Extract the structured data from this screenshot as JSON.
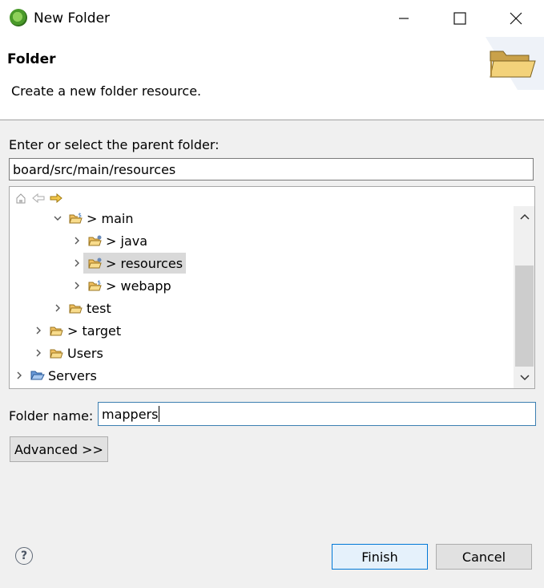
{
  "window": {
    "title": "New Folder"
  },
  "header": {
    "title": "Folder",
    "description": "Create a new folder resource."
  },
  "parent": {
    "label": "Enter or select the parent folder:",
    "value": "board/src/main/resources"
  },
  "tree": {
    "items": [
      {
        "label": "> main",
        "expanded": true,
        "icon": "source-folder-icon"
      },
      {
        "label": "> java",
        "expanded": false,
        "icon": "folder-icon"
      },
      {
        "label": "> resources",
        "expanded": false,
        "icon": "folder-icon",
        "selected": true
      },
      {
        "label": "> webapp",
        "expanded": false,
        "icon": "source-folder-icon"
      },
      {
        "label": "test",
        "expanded": false,
        "icon": "folder-icon"
      },
      {
        "label": "> target",
        "expanded": false,
        "icon": "folder-icon"
      },
      {
        "label": "Users",
        "expanded": false,
        "icon": "folder-icon"
      },
      {
        "label": "Servers",
        "expanded": false,
        "icon": "open-folder-icon"
      }
    ]
  },
  "folder_name": {
    "label": "Folder name:",
    "value": "mappers"
  },
  "buttons": {
    "advanced": "Advanced >>",
    "finish": "Finish",
    "cancel": "Cancel"
  },
  "colors": {
    "accent": "#0078d7",
    "selection": "#d9d9d9",
    "folder": "#f0c060"
  }
}
